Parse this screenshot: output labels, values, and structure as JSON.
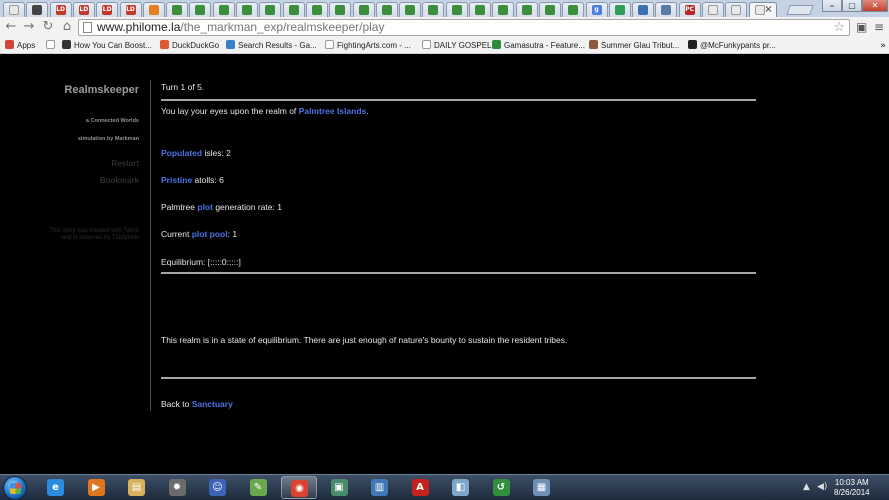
{
  "browser": {
    "url_domain": "www.philome.la",
    "url_path": "/the_markman_exp/realmskeeper/play",
    "tabs": [
      {
        "icon": "page-icon",
        "color": "#e8e8e8"
      },
      {
        "icon": "reddit-icon",
        "color": "#444444"
      },
      {
        "icon": "ld-icon",
        "color": "#c0392b",
        "text": "LD"
      },
      {
        "icon": "ld-icon",
        "color": "#c0392b",
        "text": "LD"
      },
      {
        "icon": "ld-icon",
        "color": "#c0392b",
        "text": "LD"
      },
      {
        "icon": "ld-icon",
        "color": "#c0392b",
        "text": "LD"
      },
      {
        "icon": "face-icon",
        "color": "#e67e22"
      },
      {
        "icon": "twine-icon",
        "color": "#3c8e3c"
      },
      {
        "icon": "twine-icon",
        "color": "#3c8e3c"
      },
      {
        "icon": "twine-icon",
        "color": "#3c8e3c"
      },
      {
        "icon": "twine-icon",
        "color": "#3c8e3c"
      },
      {
        "icon": "twine-icon",
        "color": "#3c8e3c"
      },
      {
        "icon": "twine-icon",
        "color": "#3c8e3c"
      },
      {
        "icon": "twine-icon",
        "color": "#3c8e3c"
      },
      {
        "icon": "twine-icon",
        "color": "#3c8e3c"
      },
      {
        "icon": "twine-icon",
        "color": "#3c8e3c"
      },
      {
        "icon": "twine-icon",
        "color": "#3c8e3c"
      },
      {
        "icon": "twine-icon",
        "color": "#3c8e3c"
      },
      {
        "icon": "twine-icon",
        "color": "#3c8e3c"
      },
      {
        "icon": "twine-icon",
        "color": "#3c8e3c"
      },
      {
        "icon": "twine-icon",
        "color": "#3c8e3c"
      },
      {
        "icon": "twine-icon",
        "color": "#3c8e3c"
      },
      {
        "icon": "twine-icon",
        "color": "#3c8e3c"
      },
      {
        "icon": "twine-icon",
        "color": "#3c8e3c"
      },
      {
        "icon": "twine-icon",
        "color": "#3c8e3c"
      },
      {
        "icon": "google-icon",
        "color": "#4a7fe0",
        "text": "g"
      },
      {
        "icon": "play-icon",
        "color": "#2f9e57"
      },
      {
        "icon": "mail-icon",
        "color": "#3b6fb6"
      },
      {
        "icon": "chat-icon",
        "color": "#5b7ba6"
      },
      {
        "icon": "pc-icon",
        "color": "#b8262a",
        "text": "PC"
      },
      {
        "icon": "page-icon",
        "color": "#e8e8e8"
      },
      {
        "icon": "page-icon",
        "color": "#e8e8e8"
      }
    ],
    "active_tab_close": "×",
    "window_controls": [
      "–",
      "▢",
      "✕"
    ],
    "back_glyph": "←",
    "forward_glyph": "→",
    "reload_glyph": "↻",
    "home_glyph": "⌂",
    "star_glyph": "☆",
    "menu_glyph": "≡"
  },
  "bookmarks": [
    {
      "label": "Apps",
      "icon": "apps-icon",
      "color": "#d1453b"
    },
    {
      "label": "",
      "icon": "page-icon",
      "color": "#ffffff"
    },
    {
      "label": "How You Can Boost...",
      "icon": "bookmark-icon",
      "color": "#333333"
    },
    {
      "label": "DuckDuckGo",
      "icon": "duckduckgo-icon",
      "color": "#de5833"
    },
    {
      "label": "Search Results - Ga...",
      "icon": "globe-icon",
      "color": "#3a80c9"
    },
    {
      "label": "FightingArts.com - ...",
      "icon": "page-icon",
      "color": "#ffffff"
    },
    {
      "label": "DAILY GOSPEL",
      "icon": "page-icon",
      "color": "#ffffff"
    },
    {
      "label": "Gamasutra - Feature...",
      "icon": "gamasutra-icon",
      "color": "#2e8a3c"
    },
    {
      "label": "Summer Glau Tribut...",
      "icon": "photo-icon",
      "color": "#8a5a3c"
    },
    {
      "label": "@McFunkypants pr...",
      "icon": "avatar-icon",
      "color": "#222222"
    }
  ],
  "bookmarks_more": "»",
  "sidebar": {
    "title": "Realmskeeper",
    "subtitle_line1": "a Connected Worlds",
    "subtitle_line2": "simulation by Markman",
    "restart_label": "Restart",
    "bookmark_label": "Bookmark",
    "credits": "This story was created with Twine and is powered by TiddlyWiki"
  },
  "passage": {
    "turn": "Turn 1 of 5.",
    "intro_prefix": "You lay your eyes upon the realm of ",
    "realm_name": "Palmtree Islands",
    "intro_suffix": ".",
    "populated_link": "Populated",
    "populated_text": " isles: 2",
    "pristine_link": "Pristine",
    "pristine_text": " atolls: 6",
    "gen_prefix": "Palmtree ",
    "gen_link": "plot",
    "gen_suffix": " generation rate: 1",
    "pool_prefix": "Current ",
    "pool_link": "plot pool",
    "pool_suffix": ": 1",
    "equilibrium": "Equilibrium: [:::::0:::::]",
    "status": "This realm is in a state of equilibrium. There are just enough of nature's bounty to sustain the resident tribes.",
    "back_prefix": "Back to ",
    "back_link": "Sanctuary"
  },
  "taskbar": {
    "apps": [
      {
        "name": "ie-icon",
        "glyph": "e",
        "color": "#2a8be0"
      },
      {
        "name": "media-player-icon",
        "glyph": "▶",
        "color": "#e0761f"
      },
      {
        "name": "explorer-icon",
        "glyph": "▤",
        "color": "#d8b25a"
      },
      {
        "name": "game-icon",
        "glyph": "✹",
        "color": "#6b6b6b"
      },
      {
        "name": "chat-app-icon",
        "glyph": "☺",
        "color": "#3c63b8"
      },
      {
        "name": "notepad-icon",
        "glyph": "✎",
        "color": "#6aa84f"
      },
      {
        "name": "chrome-icon",
        "glyph": "◉",
        "color": "#d9432f"
      },
      {
        "name": "monitor-icon",
        "glyph": "▣",
        "color": "#4a8c6a"
      },
      {
        "name": "remote-desktop-icon",
        "glyph": "▥",
        "color": "#3f79b5"
      },
      {
        "name": "acrobat-icon",
        "glyph": "A",
        "color": "#c81f1f"
      },
      {
        "name": "folder-app-icon",
        "glyph": "◧",
        "color": "#7fa7c9"
      },
      {
        "name": "green-app-icon",
        "glyph": "↺",
        "color": "#2f8f3a"
      },
      {
        "name": "document-app-icon",
        "glyph": "▦",
        "color": "#6f8fb8"
      }
    ],
    "tray_up": "▲",
    "tray_volume": "◀)",
    "time": "10:03 AM",
    "date": "8/26/2014"
  }
}
